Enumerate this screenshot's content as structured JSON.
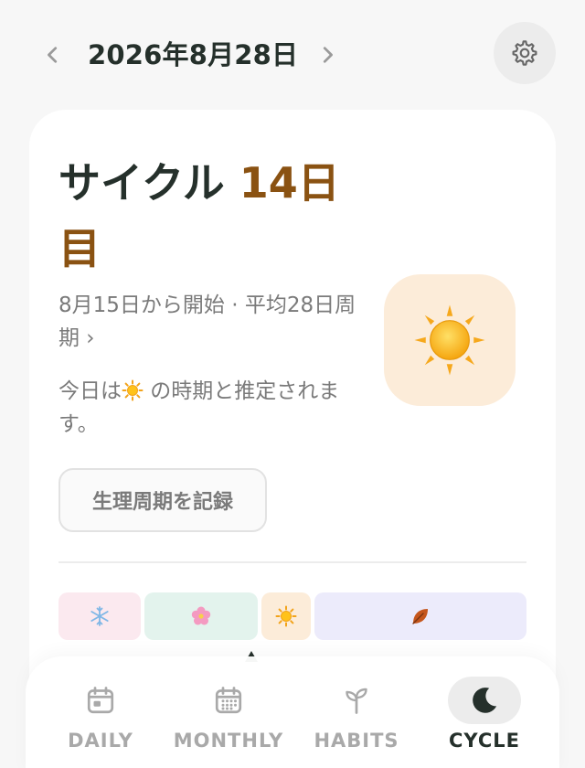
{
  "header": {
    "date": "2026年8月28日",
    "prev_icon": "chevron-left-icon",
    "next_icon": "chevron-right-icon",
    "settings_icon": "gear-icon"
  },
  "cycle": {
    "title_prefix": "サイクル",
    "title_day": "14日目",
    "start_info": "8月15日から開始 · 平均28日周期 ›",
    "today_prefix": "今日は",
    "today_suffix": " の時期と推定されます。",
    "phase_icon": "sun-icon",
    "record_button": "生理周期を記録"
  },
  "phase_bar": {
    "segments": [
      {
        "icon": "snowflake-icon",
        "color": "#fbe9ef"
      },
      {
        "icon": "flower-icon",
        "color": "#e3f3ed"
      },
      {
        "icon": "sun-icon",
        "color": "#fcecd9"
      },
      {
        "icon": "leaf-icon",
        "color": "#ecebfb"
      }
    ],
    "current_segment": 2
  },
  "tabs": [
    {
      "label": "DAILY",
      "icon": "calendar-day-icon",
      "active": false
    },
    {
      "label": "MONTHLY",
      "icon": "calendar-month-icon",
      "active": false
    },
    {
      "label": "HABITS",
      "icon": "sprout-icon",
      "active": false
    },
    {
      "label": "CYCLE",
      "icon": "moon-icon",
      "active": true
    }
  ],
  "colors": {
    "accent_day": "#8a5212",
    "text_primary": "#25302b",
    "text_secondary": "#7a7a7a",
    "tab_inactive": "#a9a9a9"
  }
}
